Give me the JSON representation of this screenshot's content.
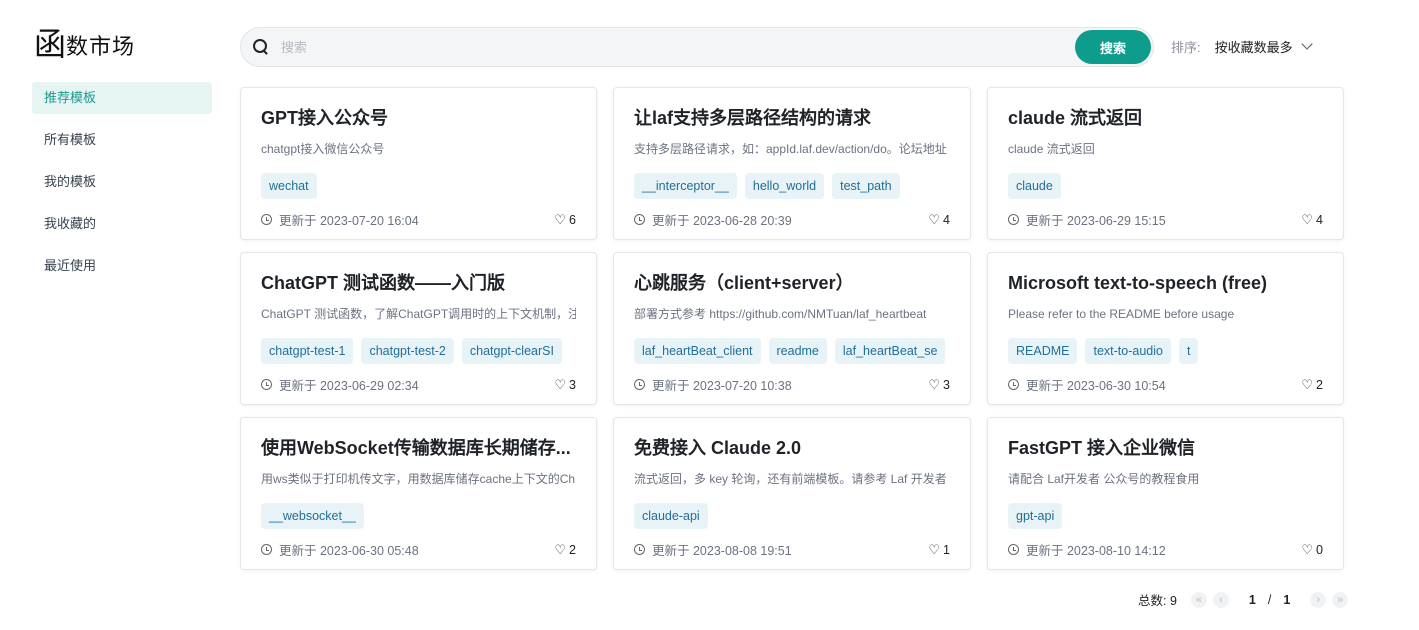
{
  "logo": {
    "glyph": "函",
    "text": "数市场"
  },
  "sidebar": {
    "items": [
      {
        "label": "推荐模板",
        "active": true
      },
      {
        "label": "所有模板",
        "active": false
      },
      {
        "label": "我的模板",
        "active": false
      },
      {
        "label": "我收藏的",
        "active": false
      },
      {
        "label": "最近使用",
        "active": false
      }
    ]
  },
  "search": {
    "placeholder": "搜索",
    "value": "",
    "button": "搜索"
  },
  "sort": {
    "label": "排序:",
    "value": "按收藏数最多"
  },
  "colors": {
    "accent": "#0e9c8c",
    "tag_bg": "#e8f3f8",
    "tag_text": "#1f6f96"
  },
  "cards": [
    {
      "title": "GPT接入公众号",
      "desc": "chatgpt接入微信公众号",
      "tags": [
        "wechat"
      ],
      "updated": "更新于 2023-07-20 16:04",
      "likes": "6"
    },
    {
      "title": "让laf支持多层路径结构的请求",
      "desc": "支持多层路径请求，如：appId.laf.dev/action/do。论坛地址",
      "tags": [
        "__interceptor__",
        "hello_world",
        "test_path"
      ],
      "updated": "更新于 2023-06-28 20:39",
      "likes": "4"
    },
    {
      "title": "claude 流式返回",
      "desc": "claude 流式返回",
      "tags": [
        "claude"
      ],
      "updated": "更新于 2023-06-29 15:15",
      "likes": "4"
    },
    {
      "title": "ChatGPT 测试函数——入门版",
      "desc": "ChatGPT 测试函数，了解ChatGPT调用时的上下文机制，注",
      "tags": [
        "chatgpt-test-1",
        "chatgpt-test-2",
        "chatgpt-clearSI"
      ],
      "updated": "更新于 2023-06-29 02:34",
      "likes": "3"
    },
    {
      "title": "心跳服务（client+server）",
      "desc": "部署方式参考 https://github.com/NMTuan/laf_heartbeat",
      "tags": [
        "laf_heartBeat_client",
        "readme",
        "laf_heartBeat_se"
      ],
      "updated": "更新于 2023-07-20 10:38",
      "likes": "3"
    },
    {
      "title": "Microsoft text-to-speech (free)",
      "desc": "Please refer to the README before usage",
      "tags": [
        "README",
        "text-to-audio",
        "t"
      ],
      "updated": "更新于 2023-06-30 10:54",
      "likes": "2"
    },
    {
      "title": "使用WebSocket传输数据库长期储存...",
      "desc": "用ws类似于打印机传文字，用数据库储存cache上下文的Ch",
      "tags": [
        "__websocket__"
      ],
      "updated": "更新于 2023-06-30 05:48",
      "likes": "2"
    },
    {
      "title": "免费接入 Claude 2.0",
      "desc": "流式返回，多 key 轮询，还有前端模板。请参考 Laf 开发者",
      "tags": [
        "claude-api"
      ],
      "updated": "更新于 2023-08-08 19:51",
      "likes": "1"
    },
    {
      "title": "FastGPT 接入企业微信",
      "desc": "请配合 Laf开发者 公众号的教程食用",
      "tags": [
        "gpt-api"
      ],
      "updated": "更新于 2023-08-10 14:12",
      "likes": "0"
    }
  ],
  "pagination": {
    "total_label": "总数: 9",
    "current": "1",
    "separator": "/",
    "pages": "1"
  }
}
